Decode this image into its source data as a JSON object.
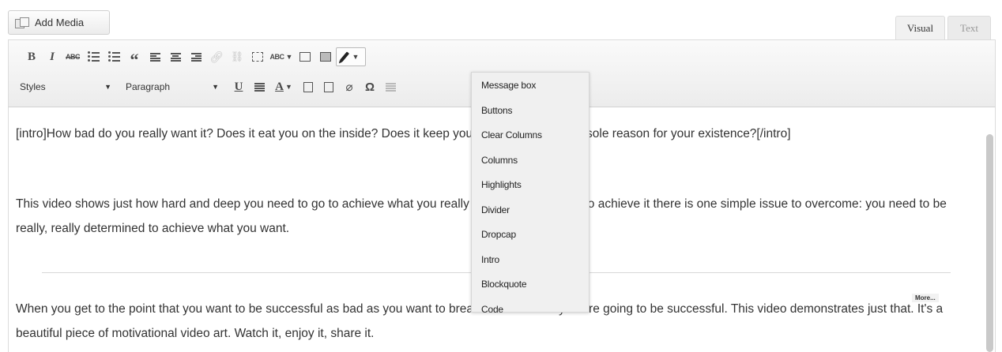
{
  "add_media": {
    "label": "Add Media"
  },
  "tabs": {
    "visual": "Visual",
    "text": "Text"
  },
  "toolbar": {
    "bold": "B",
    "italic": "I",
    "strikethrough": "ABC",
    "blockquote": "“",
    "spellcheck": "ABC",
    "styles_select": "Styles",
    "format_select": "Paragraph",
    "underline": "U",
    "text_color": "A",
    "clear_formatting": "⌀",
    "special_char": "Ω"
  },
  "shortcodes_menu": {
    "items": [
      "Message box",
      "Buttons",
      "Clear Columns",
      "Columns",
      "Highlights",
      "Divider",
      "Dropcap",
      "Intro",
      "Blockquote",
      "Code"
    ]
  },
  "editor": {
    "paragraphs": [
      "[intro]How bad do you really want it? Does it eat you on the inside? Does it keep you up at night? Is it the sole reason for your existence?[/intro]",
      "This video shows just how hard and deep you need to go to achieve what you really want. But to be able to achieve it there is one simple issue to overcome: you need to be really, really determined to achieve what you want.",
      "When you get to the point that you want to be successful as bad as you want to breathe that's when you are going to be successful. This video demonstrates just that. It's a beautiful piece of motivational video art. Watch it, enjoy it, share it."
    ],
    "more_tag": "More..."
  }
}
